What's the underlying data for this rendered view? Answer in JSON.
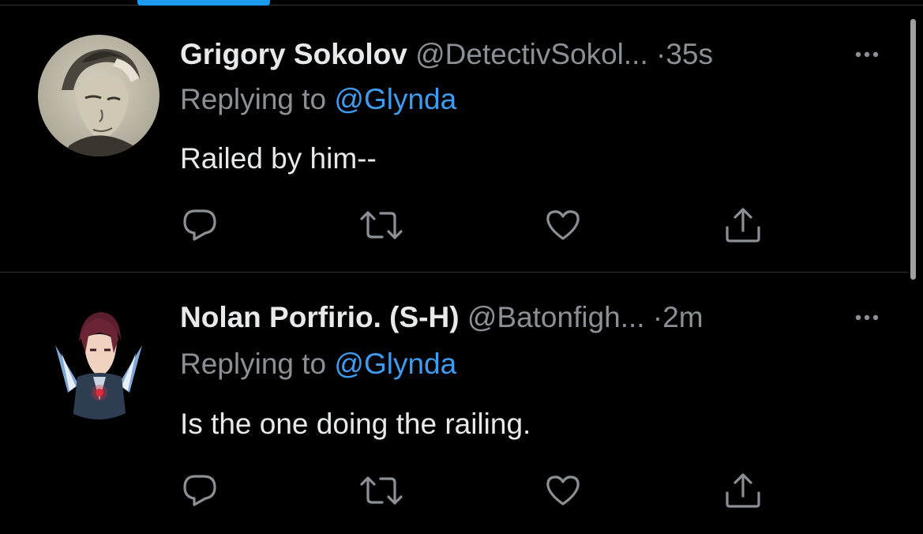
{
  "colors": {
    "background": "#000000",
    "accent": "#1d9bf0",
    "mention": "#3e9cf0",
    "secondary_text": "#8b9096",
    "primary_text": "#e7e9ea"
  },
  "tweets": [
    {
      "name": "Grigory Sokolov",
      "handle": "@DetectivSokol...",
      "dot": "·",
      "time": "35s",
      "reply_prefix": "Replying to ",
      "reply_to": "@Glynda",
      "text": "Railed by him--",
      "avatar_icon": "avatar-sketch-man",
      "actions": [
        "reply-icon",
        "retweet-icon",
        "like-icon",
        "share-icon"
      ]
    },
    {
      "name": "Nolan Porfirio. (S-H)",
      "handle": "@Batonfigh...",
      "dot": "·",
      "time": "2m",
      "reply_prefix": "Replying to ",
      "reply_to": "@Glynda",
      "text": "Is the one doing the railing.",
      "avatar_icon": "avatar-anime-character",
      "actions": [
        "reply-icon",
        "retweet-icon",
        "like-icon",
        "share-icon"
      ]
    }
  ]
}
